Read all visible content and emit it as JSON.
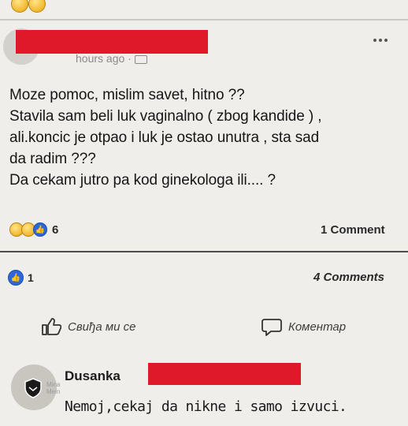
{
  "post": {
    "time": "hours ago",
    "privacy_icon": "friends-icon",
    "text_lines": [
      "Moze pomoc, mislim savet, hitno ??",
      "Stavila sam beli luk vaginalno ( zbog kandide ) ,",
      "ali.koncic je otpao i luk je ostao unutra , sta sad",
      "da radim ???",
      "Da cekam jutro pa kod ginekologa ili.... ?"
    ],
    "reaction_count": "6",
    "comment_count": "1 Comment"
  },
  "share": {
    "reaction_count": "1",
    "comment_count": "4 Comments",
    "like_label": "Свиђа ми се",
    "comment_label": "Коментар"
  },
  "comment": {
    "author": "Dusanka",
    "text": "Nemoj,cekaj da nikne i samo izvuci.",
    "watermark_line1": "Mina",
    "watermark_line2": "Mein"
  },
  "colors": {
    "background": "#efeeea",
    "redaction": "#e0192a",
    "like_blue": "#2f67d6"
  }
}
